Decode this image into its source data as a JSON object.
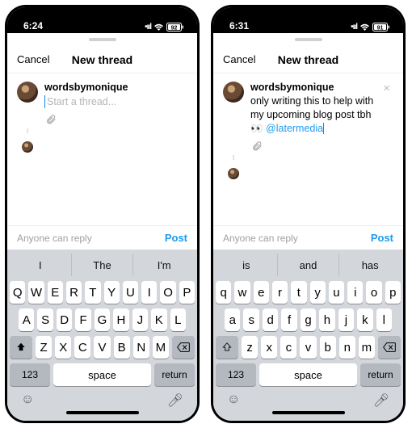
{
  "screens": [
    {
      "status": {
        "time": "6:24",
        "battery": "92"
      },
      "header": {
        "cancel": "Cancel",
        "title": "New thread"
      },
      "compose": {
        "username": "wordsbymonique",
        "placeholder": "Start a thread...",
        "body_plain": "",
        "body_emoji": "",
        "mention": ""
      },
      "footer": {
        "who": "Anyone can reply",
        "post": "Post"
      },
      "suggestions": [
        "I",
        "The",
        "I'm"
      ],
      "keys": {
        "row1": [
          "Q",
          "W",
          "E",
          "R",
          "T",
          "Y",
          "U",
          "I",
          "O",
          "P"
        ],
        "row2": [
          "A",
          "S",
          "D",
          "F",
          "G",
          "H",
          "J",
          "K",
          "L"
        ],
        "row3": [
          "Z",
          "X",
          "C",
          "V",
          "B",
          "N",
          "M"
        ],
        "num": "123",
        "space": "space",
        "ret": "return"
      }
    },
    {
      "status": {
        "time": "6:31",
        "battery": "91"
      },
      "header": {
        "cancel": "Cancel",
        "title": "New thread"
      },
      "compose": {
        "username": "wordsbymonique",
        "placeholder": "",
        "body_plain": "only writing this to help with my upcoming blog post tbh ",
        "body_emoji": "👀 ",
        "mention": "@latermedia"
      },
      "footer": {
        "who": "Anyone can reply",
        "post": "Post"
      },
      "suggestions": [
        "is",
        "and",
        "has"
      ],
      "keys": {
        "row1": [
          "q",
          "w",
          "e",
          "r",
          "t",
          "y",
          "u",
          "i",
          "o",
          "p"
        ],
        "row2": [
          "a",
          "s",
          "d",
          "f",
          "g",
          "h",
          "j",
          "k",
          "l"
        ],
        "row3": [
          "z",
          "x",
          "c",
          "v",
          "b",
          "n",
          "m"
        ],
        "num": "123",
        "space": "space",
        "ret": "return"
      }
    }
  ]
}
